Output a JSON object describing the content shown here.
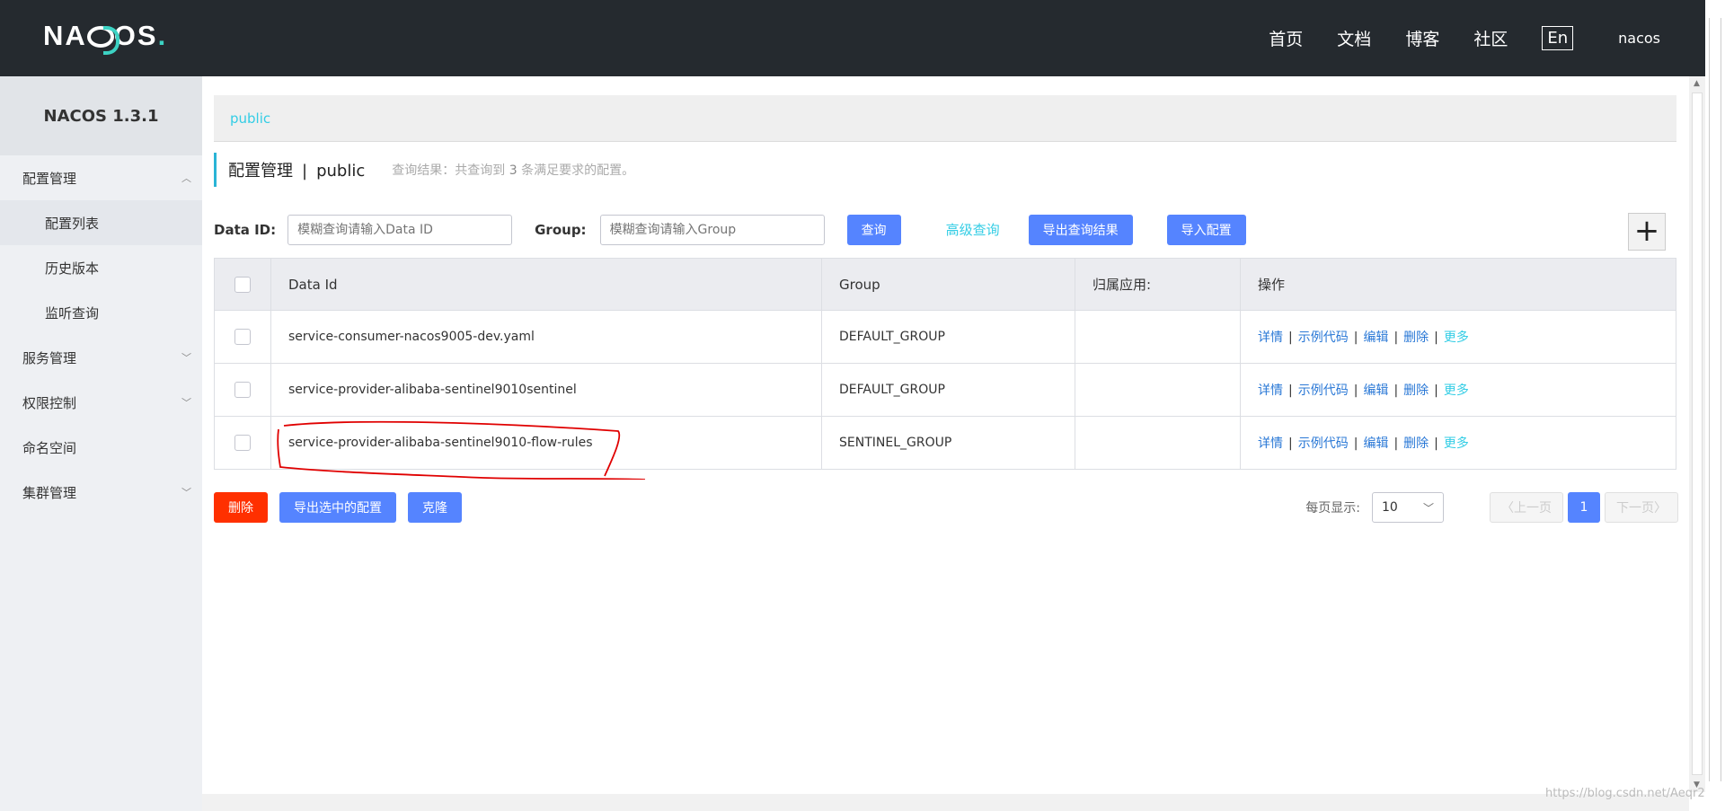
{
  "header": {
    "logo_text": "NACOS",
    "nav": [
      "首页",
      "文档",
      "博客",
      "社区"
    ],
    "lang": "En",
    "user": "nacos"
  },
  "sidebar": {
    "title": "NACOS 1.3.1",
    "config_group": "配置管理",
    "config_items": [
      "配置列表",
      "历史版本",
      "监听查询"
    ],
    "groups": [
      "服务管理",
      "权限控制",
      "命名空间",
      "集群管理"
    ]
  },
  "namespace": {
    "current": "public"
  },
  "page": {
    "title": "配置管理",
    "separator": "|",
    "namespace": "public",
    "query_prefix": "查询结果：共查询到",
    "query_count": "3",
    "query_suffix": "条满足要求的配置。"
  },
  "filter": {
    "dataid_label": "Data ID:",
    "dataid_placeholder": "模糊查询请输入Data ID",
    "group_label": "Group:",
    "group_placeholder": "模糊查询请输入Group",
    "search_btn": "查询",
    "advanced": "高级查询",
    "export_result_btn": "导出查询结果",
    "import_btn": "导入配置",
    "add_btn": "+"
  },
  "table": {
    "headers": [
      "Data Id",
      "Group",
      "归属应用:",
      "操作"
    ],
    "rows": [
      {
        "data_id": "service-consumer-nacos9005-dev.yaml",
        "group": "DEFAULT_GROUP",
        "app": ""
      },
      {
        "data_id": "service-provider-alibaba-sentinel9010sentinel",
        "group": "DEFAULT_GROUP",
        "app": ""
      },
      {
        "data_id": "service-provider-alibaba-sentinel9010-flow-rules",
        "group": "SENTINEL_GROUP",
        "app": ""
      }
    ],
    "ops": [
      "详情",
      "示例代码",
      "编辑",
      "删除",
      "更多"
    ]
  },
  "bottom": {
    "delete_btn": "删除",
    "export_selected_btn": "导出选中的配置",
    "clone_btn": "克隆",
    "page_size_label": "每页显示:",
    "page_size": "10",
    "prev": "上一页",
    "current_page": "1",
    "next": "下一页"
  },
  "watermark": "https://blog.csdn.net/Aeqr2",
  "colors": {
    "header_bg": "#252a2f",
    "primary": "#5584ff",
    "danger": "#ff3000",
    "accent": "#33cde5",
    "annotation": "#e00000"
  }
}
